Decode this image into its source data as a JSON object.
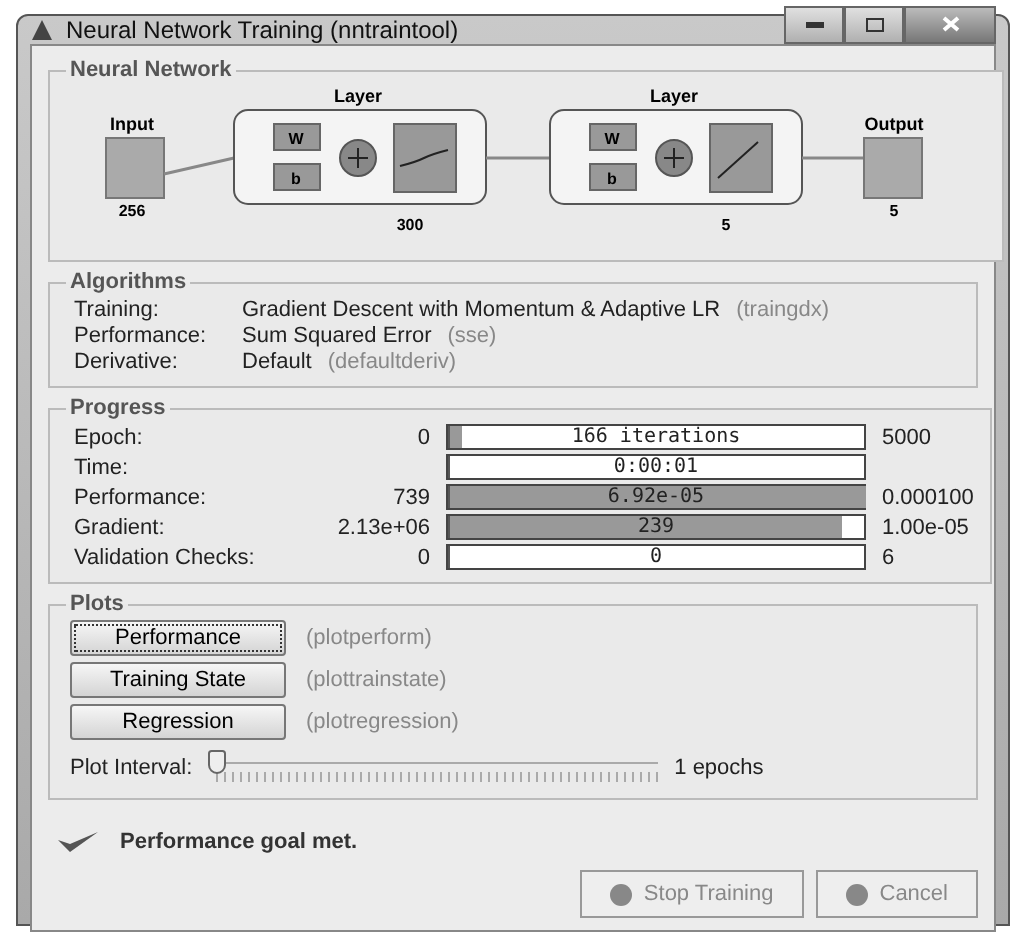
{
  "window": {
    "title": "Neural Network Training (nntraintool)"
  },
  "network": {
    "title": "Neural Network",
    "input": {
      "label": "Input",
      "size": "256"
    },
    "layers": [
      {
        "label": "Layer",
        "size": "300",
        "weight": "W",
        "bias": "b",
        "kind": "sigmoid"
      },
      {
        "label": "Layer",
        "size": "5",
        "weight": "W",
        "bias": "b",
        "kind": "linear"
      }
    ],
    "output": {
      "label": "Output",
      "size": "5"
    }
  },
  "algorithms": {
    "title": "Algorithms",
    "rows": [
      {
        "label": "Training:",
        "value": "Gradient Descent with Momentum & Adaptive LR",
        "function": "(traingdx)"
      },
      {
        "label": "Performance:",
        "value": "Sum Squared Error",
        "function": "(sse)"
      },
      {
        "label": "Derivative:",
        "value": "Default",
        "function": "(defaultderiv)"
      }
    ]
  },
  "progress": {
    "title": "Progress",
    "rows": [
      {
        "label": "Epoch:",
        "start": "0",
        "bar_text": "166 iterations",
        "end": "5000",
        "level": 0.03
      },
      {
        "label": "Time:",
        "bar_text": "0:00:01",
        "level": 0
      },
      {
        "label": "Performance:",
        "start": "739",
        "bar_text": "6.92e-05",
        "end": "0.000100",
        "level": 1
      },
      {
        "label": "Gradient:",
        "start": "2.13e+06",
        "bar_text": "239",
        "end": "1.00e-05",
        "level": 0.94
      },
      {
        "label": "Validation Checks:",
        "start": "0",
        "bar_text": "0",
        "end": "6",
        "level": 0
      }
    ]
  },
  "plots": {
    "title": "Plots",
    "buttons": [
      {
        "label": "Performance",
        "function": "(plotperform)",
        "focused": true
      },
      {
        "label": "Training State",
        "function": "(plottrainstate)",
        "focused": false
      },
      {
        "label": "Regression",
        "function": "(plotregression)",
        "focused": false
      }
    ],
    "interval": {
      "label": "Plot Interval:",
      "level": 0,
      "reading": "1 epochs"
    }
  },
  "status": "Performance goal met.",
  "buttons": [
    {
      "label": "Stop Training",
      "disabled": true
    },
    {
      "label": "Cancel",
      "disabled": true
    }
  ]
}
